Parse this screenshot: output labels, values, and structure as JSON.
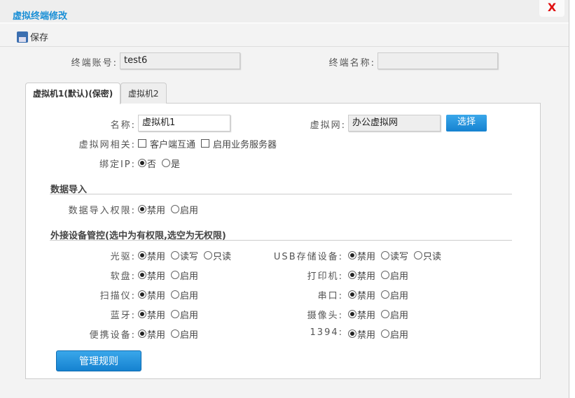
{
  "window": {
    "title": "虚拟终端修改",
    "close": "X"
  },
  "toolbar": {
    "save": "保存"
  },
  "terminal": {
    "account_label": "终端账号:",
    "account_value": "test6",
    "name_label": "终端名称:",
    "name_value": ""
  },
  "tabs": [
    {
      "label": "虚拟机1(默认)(保密)"
    },
    {
      "label": "虚拟机2"
    }
  ],
  "vm": {
    "name_label": "名称:",
    "name_value": "虚拟机1",
    "vnet_label": "虚拟网:",
    "vnet_value": "办公虚拟网",
    "select_button": "选择",
    "vnet_related_label": "虚拟网相关:",
    "vnet_options": [
      "客户端互通",
      "启用业务服务器"
    ],
    "bind_ip_label": "绑定IP:",
    "bind_ip_options": [
      "否",
      "是"
    ]
  },
  "data_import": {
    "section": "数据导入",
    "label": "数据导入权限:",
    "options": [
      "禁用",
      "启用"
    ]
  },
  "devices": {
    "section": "外接设备管控(选中为有权限,选空为无权限)",
    "left": [
      {
        "label": "光驱:",
        "options": [
          "禁用",
          "读写",
          "只读"
        ]
      },
      {
        "label": "软盘:",
        "options": [
          "禁用",
          "启用"
        ]
      },
      {
        "label": "扫描仪:",
        "options": [
          "禁用",
          "启用"
        ]
      },
      {
        "label": "蓝牙:",
        "options": [
          "禁用",
          "启用"
        ]
      },
      {
        "label": "便携设备:",
        "options": [
          "禁用",
          "启用"
        ]
      }
    ],
    "right": [
      {
        "label": "USB存储设备:",
        "options": [
          "禁用",
          "读写",
          "只读"
        ]
      },
      {
        "label": "打印机:",
        "options": [
          "禁用",
          "启用"
        ]
      },
      {
        "label": "串口:",
        "options": [
          "禁用",
          "启用"
        ]
      },
      {
        "label": "摄像头:",
        "options": [
          "禁用",
          "启用"
        ]
      },
      {
        "label": "1394:",
        "options": [
          "禁用",
          "启用"
        ]
      }
    ],
    "manage_button": "管理规则"
  }
}
